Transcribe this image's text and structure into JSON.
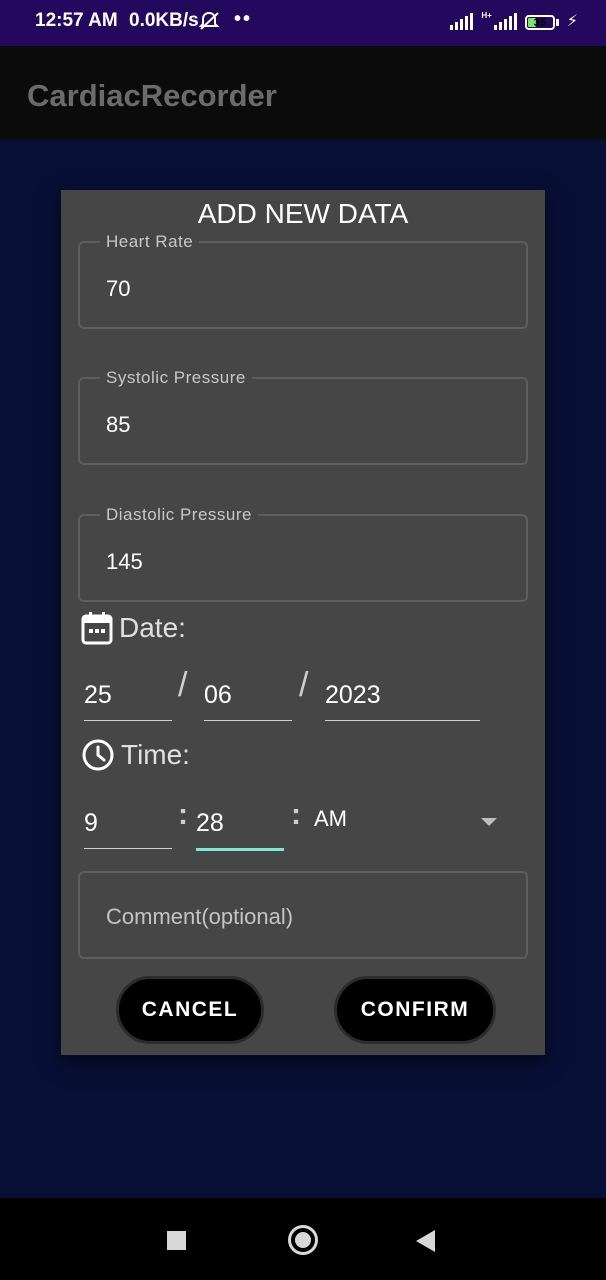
{
  "status_bar": {
    "time": "12:57 AM",
    "network_speed": "0.0KB/s",
    "more_dots": "••",
    "network_type": "H+",
    "battery_level": "35"
  },
  "app_bar": {
    "title": "CardiacRecorder"
  },
  "dialog": {
    "title": "ADD NEW DATA",
    "heart_rate": {
      "label": "Heart Rate",
      "value": "70"
    },
    "systolic": {
      "label": "Systolic Pressure",
      "value": "85"
    },
    "diastolic": {
      "label": "Diastolic Pressure",
      "value": "145"
    },
    "date": {
      "label": "Date:",
      "day": "25",
      "month": "06",
      "year": "2023",
      "separator": "/"
    },
    "time": {
      "label": "Time:",
      "hour": "9",
      "minute": "28",
      "period": "AM",
      "separator": ":"
    },
    "comment": {
      "placeholder": "Comment(optional)"
    },
    "buttons": {
      "cancel": "CANCEL",
      "confirm": "CONFIRM"
    }
  },
  "colors": {
    "background": "#070f36",
    "status_bar": "#24085e",
    "dialog": "#464646",
    "focus_underline": "#7de8d6"
  },
  "icons": [
    "calendar-icon",
    "clock-icon",
    "dropdown-arrow-icon",
    "recents-icon",
    "home-icon",
    "back-icon"
  ]
}
